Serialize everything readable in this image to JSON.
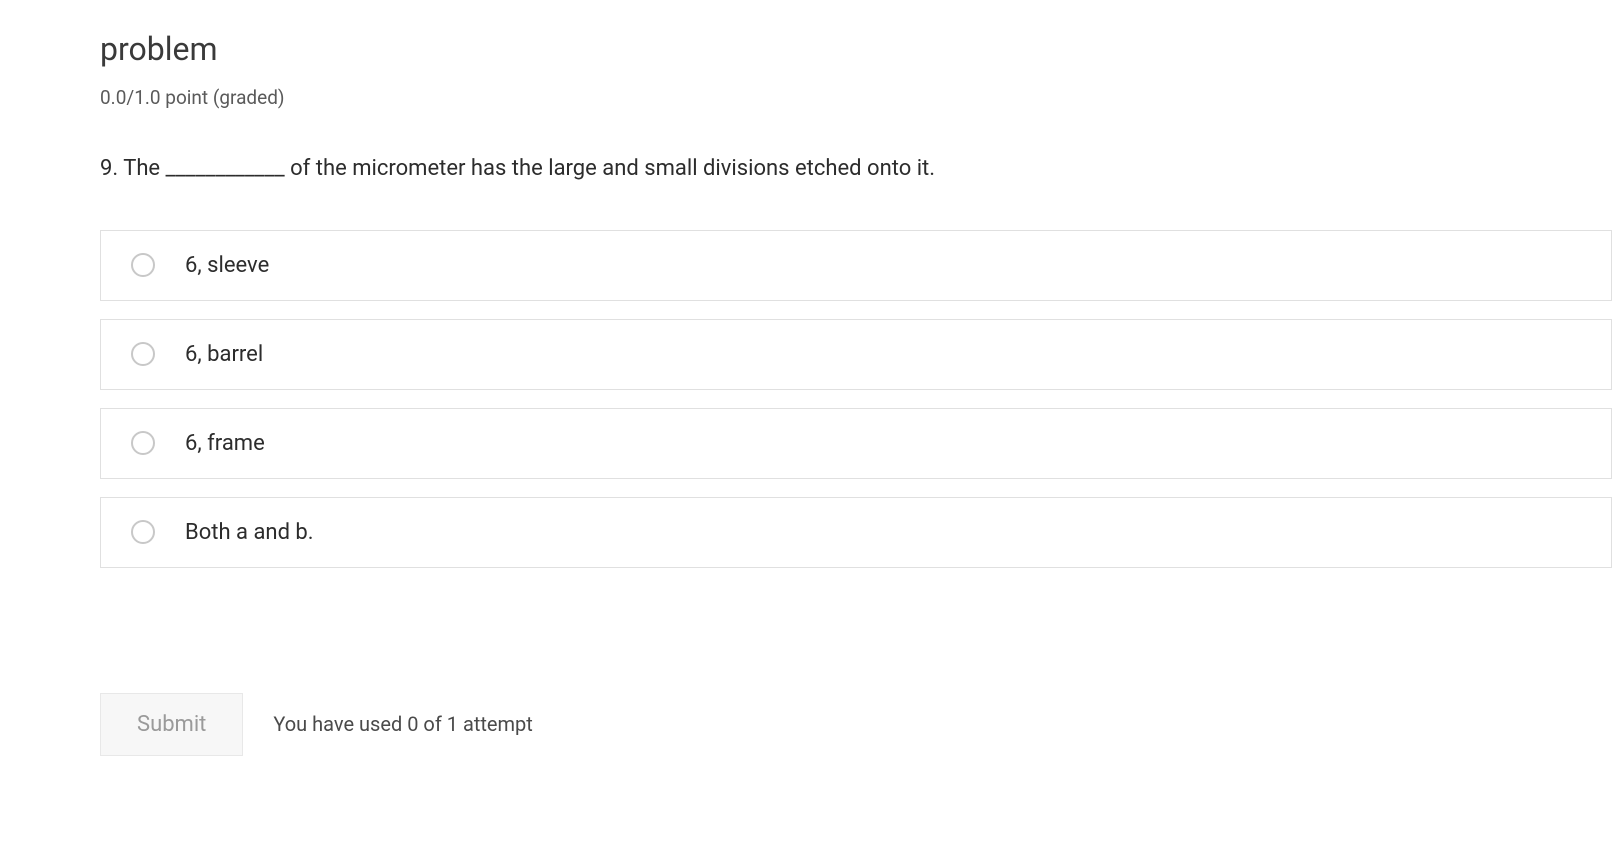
{
  "heading": "problem",
  "points": "0.0/1.0 point (graded)",
  "question": "9. The ____________ of the micrometer has the large and small divisions etched onto it.",
  "options": [
    "6, sleeve",
    "6, barrel",
    "6, frame",
    "Both a and b."
  ],
  "submit_label": "Submit",
  "attempts": "You have used 0 of 1 attempt"
}
